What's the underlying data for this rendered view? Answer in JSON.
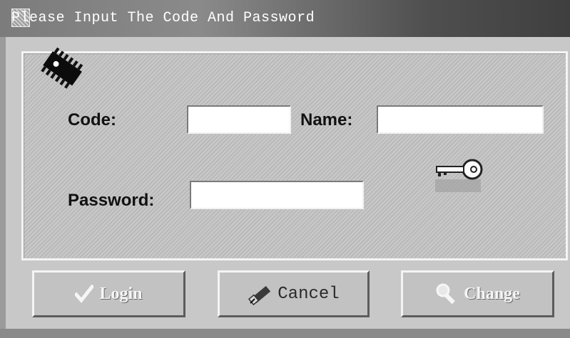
{
  "window": {
    "title": "Please Input The Code And Password"
  },
  "form": {
    "code_label": "Code:",
    "name_label": "Name:",
    "password_label": "Password:",
    "code_value": "",
    "name_value": "",
    "password_value": ""
  },
  "buttons": {
    "login_label": "Login",
    "cancel_label": "Cancel",
    "change_label": "Change"
  },
  "icons": [
    "chip-icon",
    "key-icon",
    "checkmark-icon",
    "eraser-icon",
    "magnifier-icon"
  ]
}
